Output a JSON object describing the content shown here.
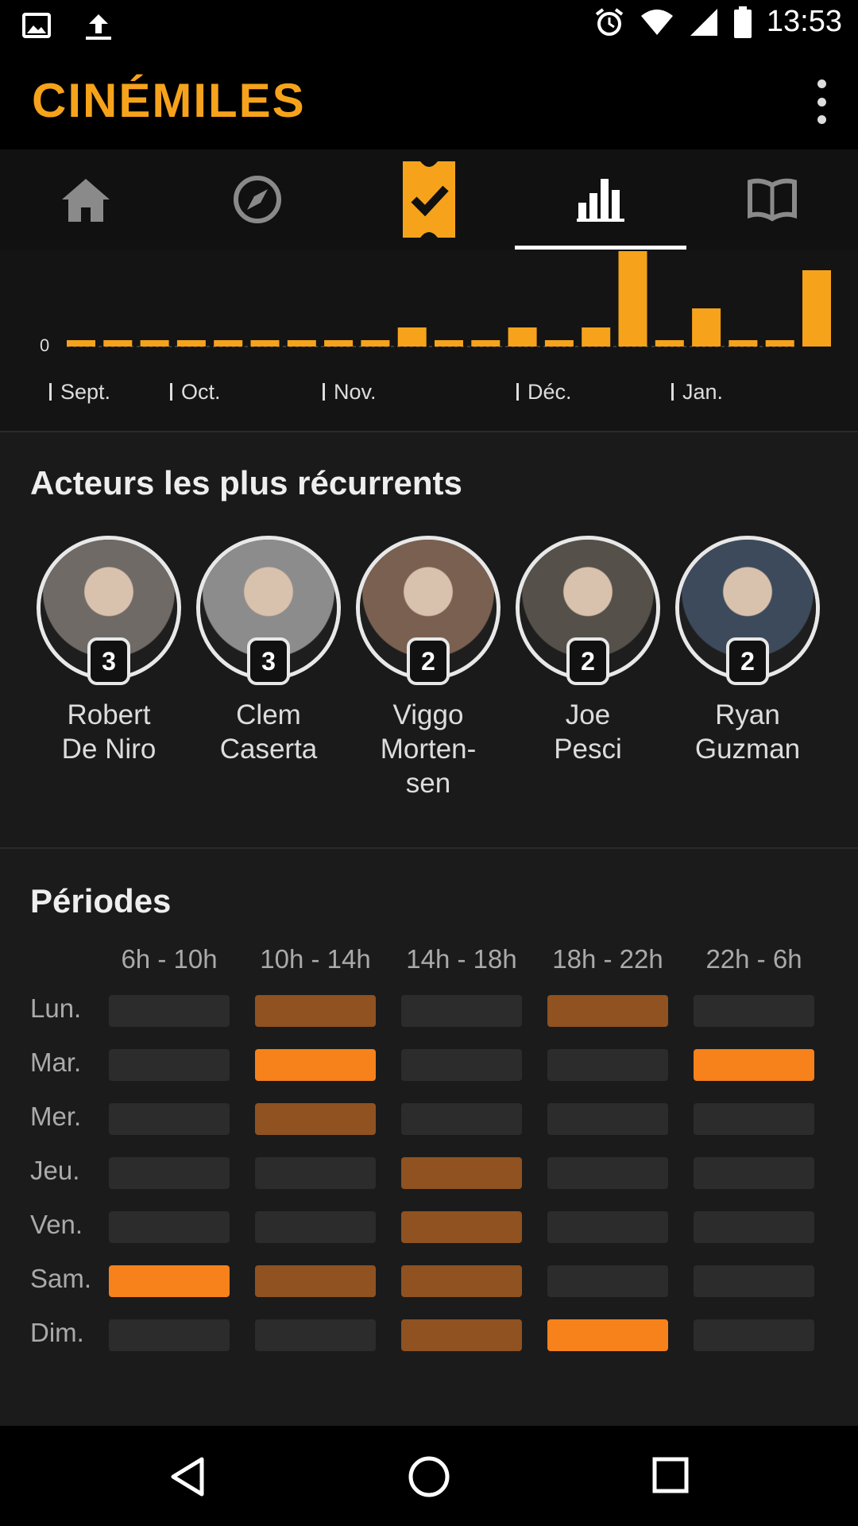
{
  "status_bar": {
    "time": "13:53",
    "left_icons": [
      "image-icon",
      "upload-icon"
    ],
    "right_icons": [
      "alarm-icon",
      "wifi-icon",
      "signal-icon",
      "battery-icon"
    ]
  },
  "app": {
    "title": "CINÉMILES",
    "brand_color": "#f6a31b"
  },
  "tabs": [
    {
      "name": "home-icon",
      "active": false
    },
    {
      "name": "compass-icon",
      "active": false
    },
    {
      "name": "ticket-check-icon",
      "active": false
    },
    {
      "name": "bar-chart-icon",
      "active": true
    },
    {
      "name": "book-icon",
      "active": false
    }
  ],
  "chart_data": {
    "type": "bar",
    "y_tick": "0",
    "month_labels": [
      "Sept.",
      "Oct.",
      "Nov.",
      "Déc.",
      "Jan."
    ],
    "values": [
      0,
      0,
      0,
      0,
      0,
      0,
      0,
      0,
      0,
      1,
      0,
      0,
      1,
      0,
      1,
      5,
      0,
      2,
      0,
      0,
      4
    ],
    "color": "#f6a31b"
  },
  "actors": {
    "title": "Acteurs les plus récurrents",
    "items": [
      {
        "line1": "Robert",
        "line2": "De Niro",
        "line3": "",
        "count": "3"
      },
      {
        "line1": "Clem",
        "line2": "Caserta",
        "line3": "",
        "count": "3"
      },
      {
        "line1": "Viggo",
        "line2": "Morten-",
        "line3": "sen",
        "count": "2"
      },
      {
        "line1": "Joe",
        "line2": "Pesci",
        "line3": "",
        "count": "2"
      },
      {
        "line1": "Ryan",
        "line2": "Guzman",
        "line3": "",
        "count": "2"
      }
    ]
  },
  "periods": {
    "title": "Périodes",
    "columns": [
      "6h - 10h",
      "10h - 14h",
      "14h - 18h",
      "18h - 22h",
      "22h - 6h"
    ],
    "rows": [
      "Lun.",
      "Mar.",
      "Mer.",
      "Jeu.",
      "Ven.",
      "Sam.",
      "Dim."
    ],
    "levels": [
      [
        0,
        1,
        0,
        1,
        0
      ],
      [
        0,
        2,
        0,
        0,
        2
      ],
      [
        0,
        1,
        0,
        0,
        0
      ],
      [
        0,
        0,
        1,
        0,
        0
      ],
      [
        0,
        0,
        1,
        0,
        0
      ],
      [
        2,
        1,
        1,
        0,
        0
      ],
      [
        0,
        0,
        1,
        2,
        0
      ]
    ],
    "colors": {
      "empty": "#2c2c2c",
      "mid": "#8f5220",
      "high": "#f7811b"
    }
  },
  "nav": {
    "back": "back-icon",
    "home": "home-circle-icon",
    "recents": "recents-icon"
  }
}
